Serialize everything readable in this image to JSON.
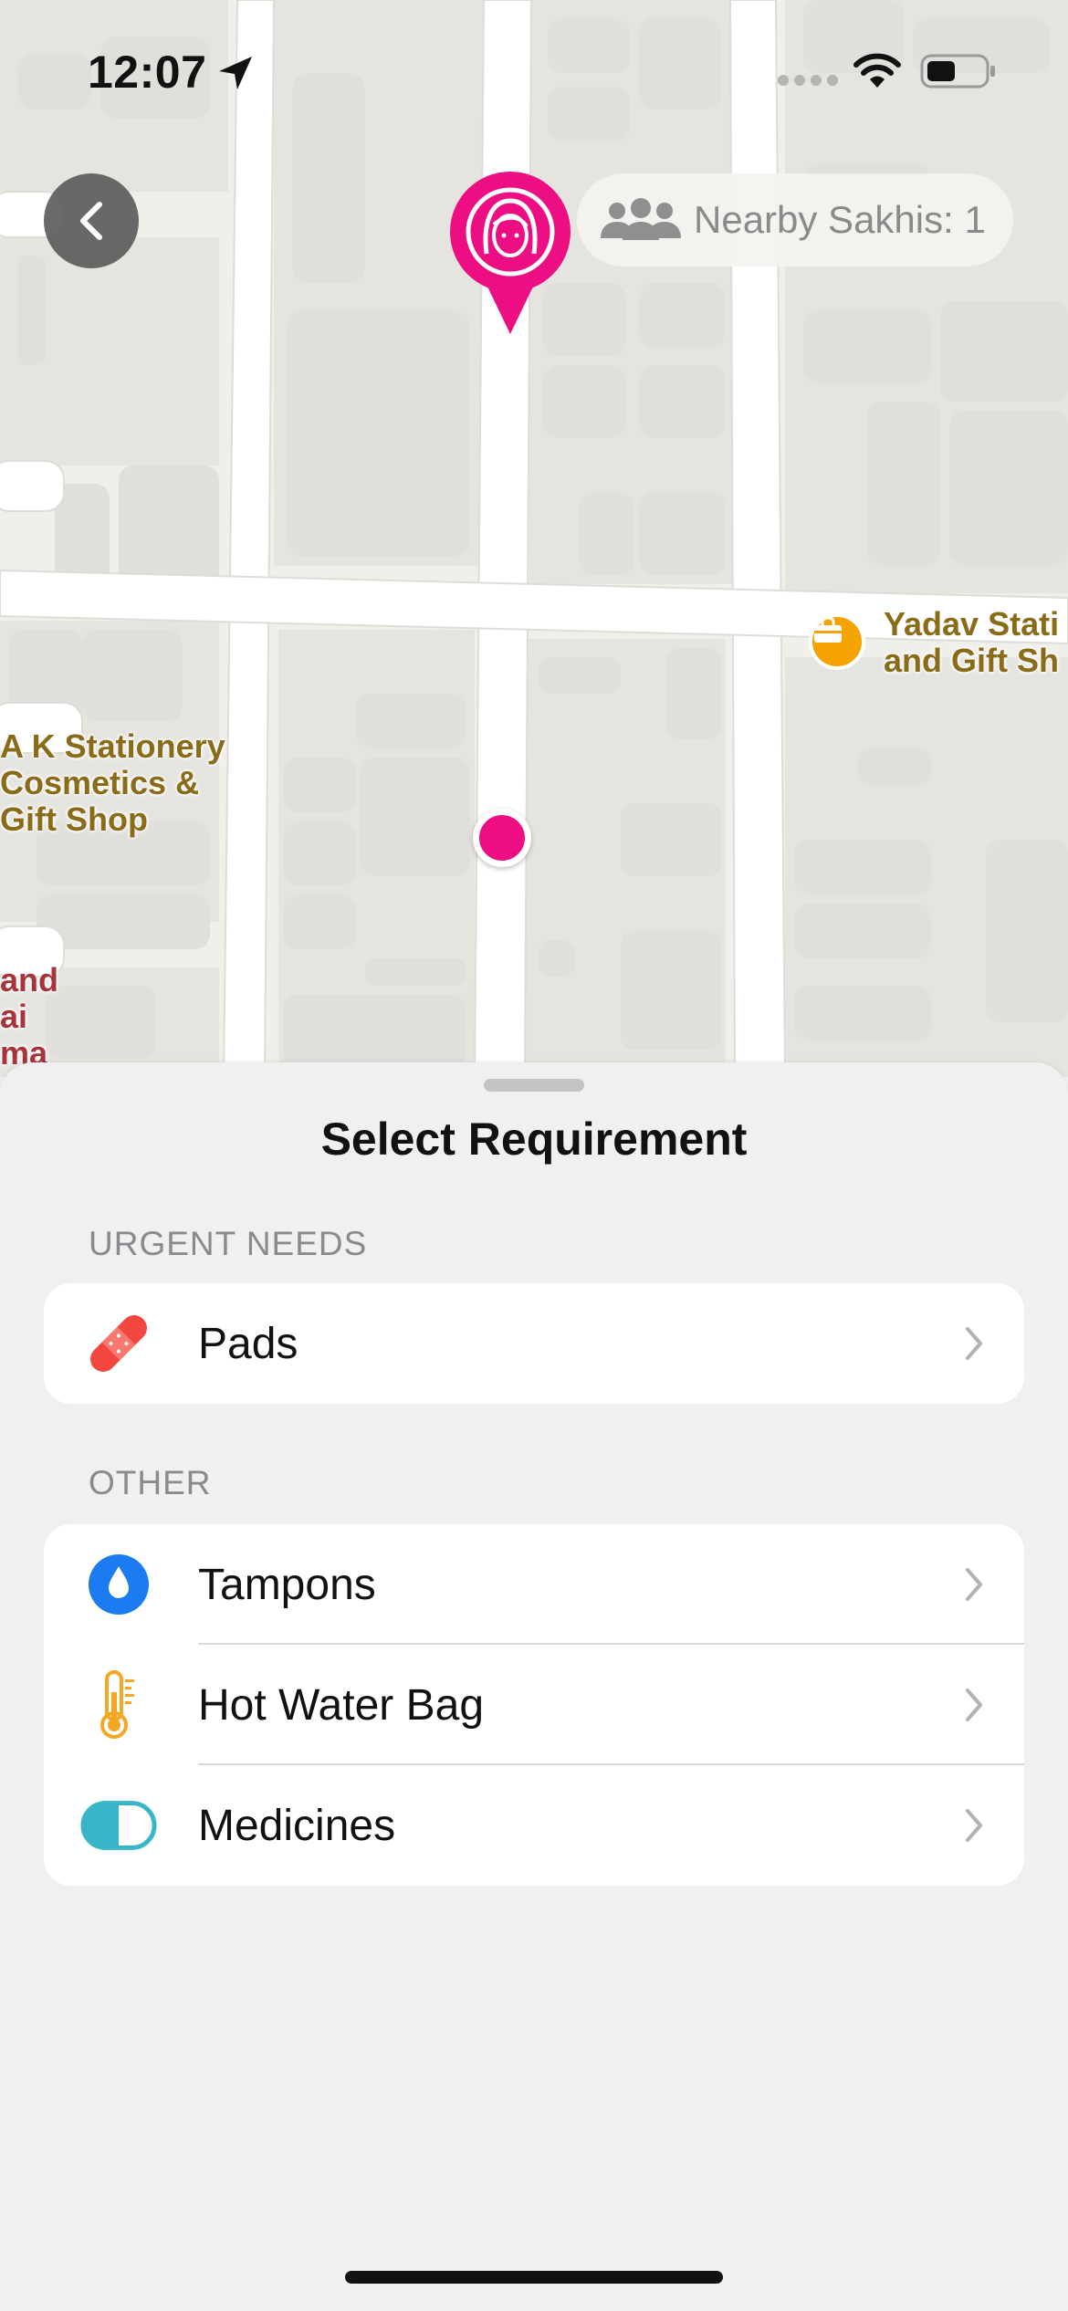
{
  "status_bar": {
    "time": "12:07"
  },
  "map": {
    "nearby_label": "Nearby Sakhis: 1",
    "pois": [
      {
        "lines": [
          "Yadav Stati",
          "and Gift Sh"
        ],
        "icon": "shopping-bag-icon"
      },
      {
        "lines": [
          "A K Stationery",
          "Cosmetics &",
          "Gift Shop"
        ]
      },
      {
        "lines": [
          "and",
          "ai",
          "ma"
        ]
      }
    ]
  },
  "sheet": {
    "title": "Select Requirement",
    "sections": [
      {
        "header": "URGENT NEEDS",
        "items": [
          {
            "label": "Pads",
            "icon": "bandage-icon",
            "color": "#f2473f"
          }
        ]
      },
      {
        "header": "OTHER",
        "items": [
          {
            "label": "Tampons",
            "icon": "drop-icon",
            "color": "#1b7bf1"
          },
          {
            "label": "Hot Water Bag",
            "icon": "thermometer-icon",
            "color": "#f5a623"
          },
          {
            "label": "Medicines",
            "icon": "pill-icon",
            "color": "#36b6c8"
          }
        ]
      }
    ]
  },
  "colors": {
    "accent": "#ec0e82",
    "pill_bg": "#f4f3f0",
    "back_button": "#555555"
  }
}
